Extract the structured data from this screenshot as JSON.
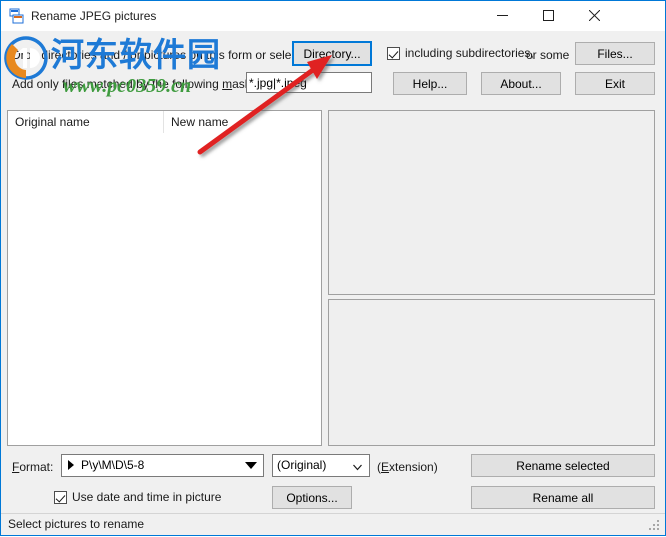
{
  "window": {
    "title": "Rename JPEG pictures",
    "icon": "app-window-icon",
    "accent_color": "#0078d7",
    "background_color": "#f0f0f0",
    "caption_buttons": {
      "minimize": "minimize-icon",
      "maximize": "maximize-icon",
      "close": "close-icon"
    }
  },
  "form": {
    "drop_hint": "Drop directories and / or pictures on this form or select a",
    "mask_label_before": "Add only files matched by the following ",
    "mask_label_accel": "m",
    "mask_label_after": "ask(s) :",
    "mask_value": "*.jpg|*.jpeg",
    "mask_placeholder": "*.jpg|*.jpeg",
    "including_subdirectories": "including subdirectories,",
    "including_subdirectories_checked": true,
    "or_some": "or some"
  },
  "buttons": {
    "directory": "Directory...",
    "directory_focused": true,
    "files": "Files...",
    "help": "Help...",
    "about": "About...",
    "exit": "Exit",
    "options": "Options...",
    "rename_selected": "Rename selected",
    "rename_all": "Rename all"
  },
  "list": {
    "columns": [
      "Original name",
      "New name"
    ],
    "rows": []
  },
  "preview": {
    "top_panel": "",
    "bottom_panel": ""
  },
  "format": {
    "label_accel": "F",
    "label_rest": "ormat:",
    "value": "P\\y\\M\\D\\5-8",
    "extension_value": "(Original)",
    "extension_suffix_before": "(",
    "extension_suffix_accel": "E",
    "extension_suffix_after": "xtension)",
    "use_date_label": "Use date and time in picture",
    "use_date_checked": true
  },
  "status": {
    "text": "Select pictures to rename"
  },
  "watermark": {
    "chinese": "河东软件园",
    "url": "www.pc0359.cn",
    "chinese_color": "#1e7ad6",
    "url_color": "#3f9b3f"
  },
  "annotation": {
    "type": "red-arrow",
    "color": "#e02020",
    "points_to": "Directory..."
  }
}
